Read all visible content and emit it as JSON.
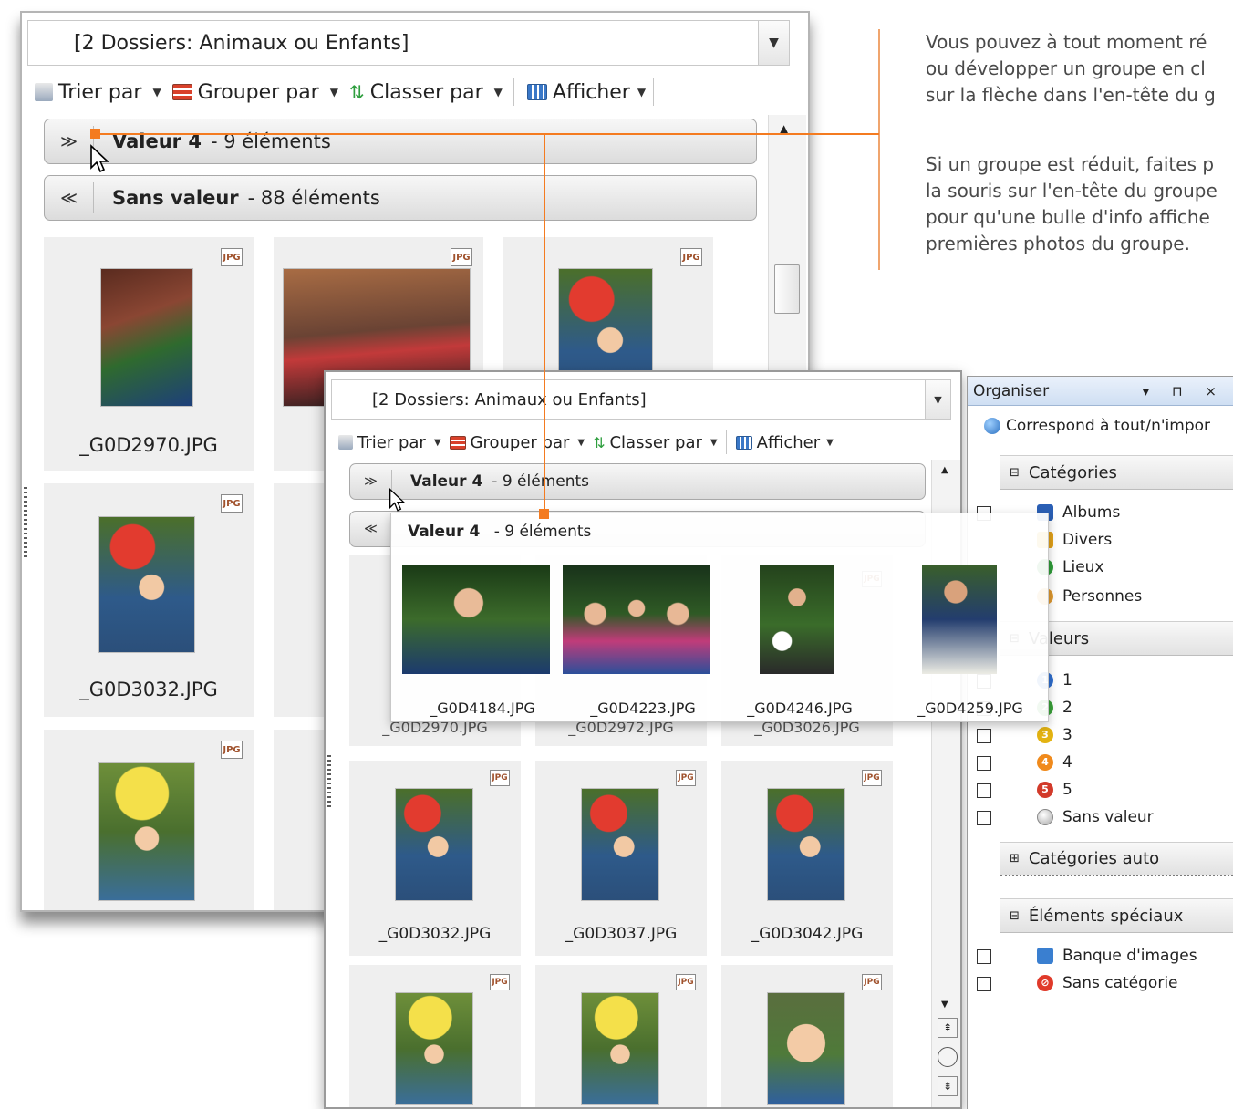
{
  "folder_label": "[2 Dossiers: Animaux ou Enfants]",
  "toolbar": {
    "sort": "Trier par",
    "group": "Grouper par",
    "rank": "Classer par",
    "view": "Afficher"
  },
  "back_window": {
    "groups": [
      {
        "name": "Valeur 4",
        "count": "- 9 éléments"
      },
      {
        "name": "Sans valeur",
        "count": "- 88 éléments"
      }
    ],
    "files": [
      "_G0D2970.JPG",
      "_G0D3032.JPG"
    ]
  },
  "front_window": {
    "groups": [
      {
        "name": "Valeur 4",
        "count": "- 9 éléments"
      }
    ],
    "hidden_files": [
      "_G0D2970.JPG",
      "_G0D2972.JPG",
      "_G0D3026.JPG"
    ],
    "files": [
      "_G0D3032.JPG",
      "_G0D3037.JPG",
      "_G0D3042.JPG"
    ]
  },
  "popup": {
    "name": "Valeur 4",
    "count": "- 9 éléments",
    "files": [
      "_G0D4184.JPG",
      "_G0D4223.JPG",
      "_G0D4246.JPG",
      "_G0D4259.JPG"
    ]
  },
  "jpg_badge": "JPG",
  "organiser": {
    "title": "Organiser",
    "controls": "▾ ⊓ ×",
    "match": "Correspond à tout/n'impor",
    "categories": {
      "header": "Catégories",
      "items": [
        "Albums",
        "Divers",
        "Lieux",
        "Personnes"
      ]
    },
    "values": {
      "header": "Valeurs",
      "items": [
        "1",
        "2",
        "3",
        "4",
        "5",
        "Sans valeur"
      ]
    },
    "auto": "Catégories auto",
    "special": {
      "header": "Éléments spéciaux",
      "items": [
        "Banque d'images",
        "Sans catégorie"
      ]
    }
  },
  "callout": {
    "p1": [
      "Vous pouvez à tout moment ré",
      "ou développer un groupe en cl",
      "sur la flèche dans l'en-tête du g"
    ],
    "p2": [
      "Si un groupe est réduit, faites p",
      "la souris sur l'en-tête du groupe",
      "pour qu'une bulle d'info affiche",
      "premières photos du groupe."
    ]
  },
  "colors": {
    "accent": "#f47b20",
    "value_badges": [
      "#2f6fd0",
      "#3aa33a",
      "#e3b312",
      "#f08a1c",
      "#d23a2a",
      "#c8c8c8"
    ]
  }
}
